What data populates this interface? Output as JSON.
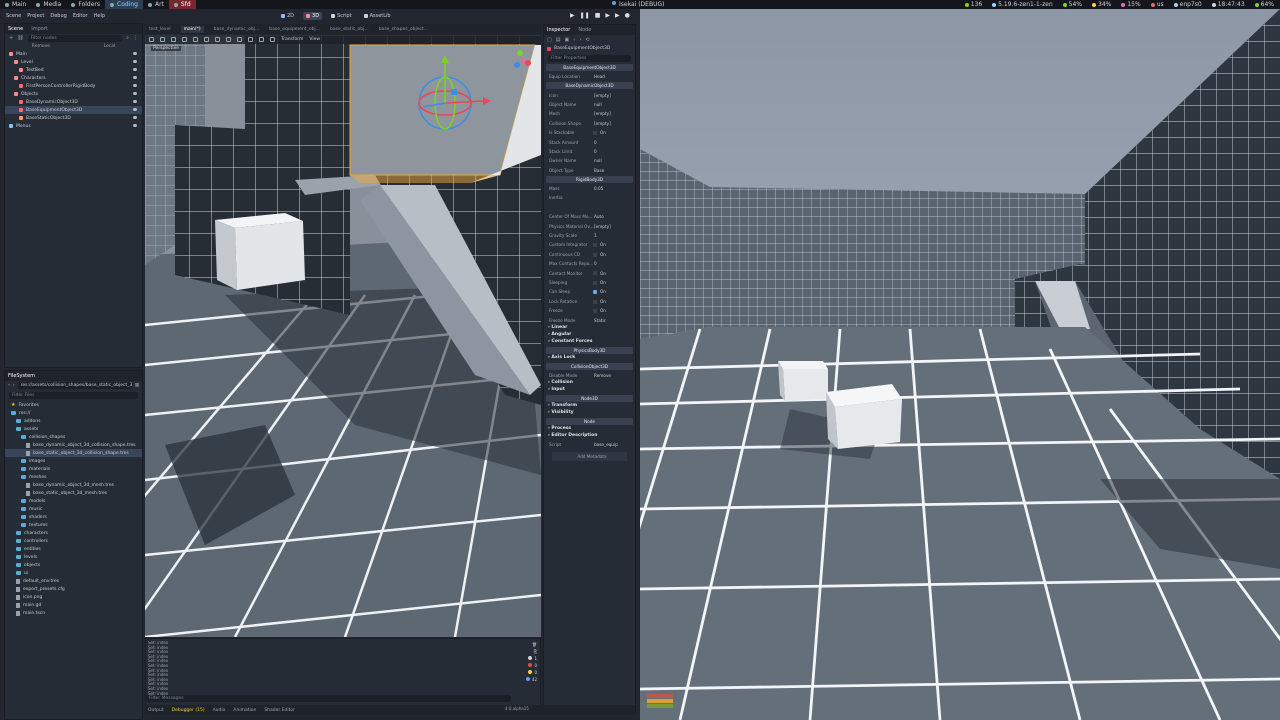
{
  "topbar": {
    "workspaces": [
      {
        "label": "Main",
        "state": "normal"
      },
      {
        "label": "Media",
        "state": "normal"
      },
      {
        "label": "Folders",
        "state": "normal"
      },
      {
        "label": "Coding",
        "state": "active"
      },
      {
        "label": "Art",
        "state": "normal"
      },
      {
        "label": "Sfd",
        "state": "red"
      }
    ],
    "window_title": "Isekai (DEBUG)",
    "stats": {
      "updates": "136",
      "kernel": "5.19.6-zen1-1-zen",
      "cpu": "54%",
      "mem": "34%",
      "disk": "15%",
      "layout": "us",
      "net": "enp7s0",
      "time": "18:47:43",
      "battery": "64%"
    }
  },
  "menu": [
    "Scene",
    "Project",
    "Debug",
    "Editor",
    "Help"
  ],
  "main_screens": [
    "2D",
    "3D",
    "Script",
    "AssetLib"
  ],
  "scene_dock": {
    "tabs": [
      "Scene",
      "Import"
    ],
    "toolbar": [
      "Remove",
      "Local"
    ],
    "filter_placeholder": "Filter nodes",
    "nodes": [
      {
        "label": "Main",
        "indent": 0,
        "icon": "node3d-icon"
      },
      {
        "label": "Level",
        "indent": 1,
        "icon": "node3d-icon"
      },
      {
        "label": "TestBed",
        "indent": 2,
        "icon": "node3d-icon"
      },
      {
        "label": "Characters",
        "indent": 1,
        "icon": "node3d-icon"
      },
      {
        "label": "FirstPersonControllerRigidBody",
        "indent": 2,
        "icon": "rigidbody-icon"
      },
      {
        "label": "Objects",
        "indent": 1,
        "icon": "node3d-icon"
      },
      {
        "label": "BaseDynamicObject3D",
        "indent": 2,
        "icon": "rigidbody-icon"
      },
      {
        "label": "BaseEquipmentObject3D",
        "indent": 2,
        "icon": "rigidbody-icon",
        "selected": true
      },
      {
        "label": "BaseStaticObject3D",
        "indent": 2,
        "icon": "staticbody-icon"
      },
      {
        "label": "Menus",
        "indent": 0,
        "icon": "control-icon"
      }
    ]
  },
  "filesystem": {
    "title": "FileSystem",
    "path": "res://assets/collision_shapes/base_static_object_3d_colli",
    "filter_placeholder": "Filter Files",
    "items": [
      {
        "label": "Favorites",
        "indent": 0,
        "type": "star"
      },
      {
        "label": "res://",
        "indent": 0,
        "type": "folder"
      },
      {
        "label": "addons",
        "indent": 1,
        "type": "folder"
      },
      {
        "label": "assets",
        "indent": 1,
        "type": "folder"
      },
      {
        "label": "collision_shapes",
        "indent": 2,
        "type": "folder"
      },
      {
        "label": "base_dynamic_object_3d_collision_shape.tres",
        "indent": 3,
        "type": "file"
      },
      {
        "label": "base_static_object_3d_collision_shape.tres",
        "indent": 3,
        "type": "file",
        "selected": true
      },
      {
        "label": "images",
        "indent": 2,
        "type": "folder"
      },
      {
        "label": "materials",
        "indent": 2,
        "type": "folder"
      },
      {
        "label": "meshes",
        "indent": 2,
        "type": "folder"
      },
      {
        "label": "base_dynamic_object_3d_mesh.tres",
        "indent": 3,
        "type": "file"
      },
      {
        "label": "base_static_object_3d_mesh.tres",
        "indent": 3,
        "type": "file"
      },
      {
        "label": "models",
        "indent": 2,
        "type": "folder"
      },
      {
        "label": "music",
        "indent": 2,
        "type": "folder"
      },
      {
        "label": "shaders",
        "indent": 2,
        "type": "folder"
      },
      {
        "label": "textures",
        "indent": 2,
        "type": "folder"
      },
      {
        "label": "characters",
        "indent": 1,
        "type": "folder"
      },
      {
        "label": "controllers",
        "indent": 1,
        "type": "folder"
      },
      {
        "label": "entities",
        "indent": 1,
        "type": "folder"
      },
      {
        "label": "levels",
        "indent": 1,
        "type": "folder"
      },
      {
        "label": "objects",
        "indent": 1,
        "type": "folder"
      },
      {
        "label": "ui",
        "indent": 1,
        "type": "folder"
      },
      {
        "label": "default_env.tres",
        "indent": 1,
        "type": "file"
      },
      {
        "label": "export_presets.cfg",
        "indent": 1,
        "type": "file"
      },
      {
        "label": "icon.png",
        "indent": 1,
        "type": "file"
      },
      {
        "label": "main.gd",
        "indent": 1,
        "type": "file"
      },
      {
        "label": "main.tscn",
        "indent": 1,
        "type": "file"
      }
    ]
  },
  "scene_tabs": [
    "test_level",
    "main(*)",
    "base_dynamic_obj...",
    "base_equipment_obj...",
    "base_static_obj...",
    "base_shapes_object..."
  ],
  "viewport": {
    "label": "Perspective",
    "toolbar": [
      "Transform",
      "View"
    ]
  },
  "inspector": {
    "tabs": [
      "Inspector",
      "Node"
    ],
    "object": "BaseEquipmentObject3D",
    "filter_placeholder": "Filter Properties",
    "rows": [
      {
        "kind": "section",
        "label": "BaseEquipmentObject3D"
      },
      {
        "kind": "prop",
        "label": "Equip Location",
        "value": "Head"
      },
      {
        "kind": "section",
        "label": "BaseDynamicObject3D"
      },
      {
        "kind": "prop",
        "label": "Icon",
        "value": "[empty]"
      },
      {
        "kind": "prop",
        "label": "Object Name",
        "value": "null"
      },
      {
        "kind": "prop",
        "label": "Mesh",
        "value": "[empty]"
      },
      {
        "kind": "prop",
        "label": "Collision Shape",
        "value": "[empty]"
      },
      {
        "kind": "check",
        "label": "Is Stackable",
        "value": "On",
        "checked": false
      },
      {
        "kind": "prop",
        "label": "Stack Amount",
        "value": "0"
      },
      {
        "kind": "prop",
        "label": "Stack Limit",
        "value": "0"
      },
      {
        "kind": "prop",
        "label": "Owner Name",
        "value": "null"
      },
      {
        "kind": "prop",
        "label": "Object Type",
        "value": "Base"
      },
      {
        "kind": "section",
        "label": "RigidBody3D"
      },
      {
        "kind": "prop",
        "label": "Mass",
        "value": "0.05"
      },
      {
        "kind": "prop",
        "label": "Inertia",
        "value": ""
      },
      {
        "kind": "prop",
        "label": "",
        "value": ""
      },
      {
        "kind": "prop",
        "label": "Center Of Mass Mo...",
        "value": "Auto"
      },
      {
        "kind": "prop",
        "label": "Physics Material Ov...",
        "value": "[empty]"
      },
      {
        "kind": "prop",
        "label": "Gravity Scale",
        "value": "1"
      },
      {
        "kind": "check",
        "label": "Custom Integrator",
        "value": "On",
        "checked": false
      },
      {
        "kind": "check",
        "label": "Continuous CD",
        "value": "On",
        "checked": false
      },
      {
        "kind": "prop",
        "label": "Max Contacts Repo...",
        "value": "0"
      },
      {
        "kind": "check",
        "label": "Contact Monitor",
        "value": "On",
        "checked": false
      },
      {
        "kind": "check",
        "label": "Sleeping",
        "value": "On",
        "checked": false
      },
      {
        "kind": "check",
        "label": "Can Sleep",
        "value": "On",
        "checked": true
      },
      {
        "kind": "check",
        "label": "Lock Rotation",
        "value": "On",
        "checked": false
      },
      {
        "kind": "check",
        "label": "Freeze",
        "value": "On",
        "checked": false
      },
      {
        "kind": "prop",
        "label": "Freeze Mode",
        "value": "Static"
      },
      {
        "kind": "group",
        "label": "Linear"
      },
      {
        "kind": "group",
        "label": "Angular"
      },
      {
        "kind": "group",
        "label": "Constant Forces"
      },
      {
        "kind": "section",
        "label": "PhysicsBody3D"
      },
      {
        "kind": "group",
        "label": "Axis Lock"
      },
      {
        "kind": "section",
        "label": "CollisionObject3D"
      },
      {
        "kind": "prop",
        "label": "Disable Mode",
        "value": "Remove"
      },
      {
        "kind": "group",
        "label": "Collision"
      },
      {
        "kind": "group",
        "label": "Input"
      },
      {
        "kind": "section",
        "label": "Node3D"
      },
      {
        "kind": "group",
        "label": "Transform"
      },
      {
        "kind": "group",
        "label": "Visibility"
      },
      {
        "kind": "section",
        "label": "Node"
      },
      {
        "kind": "group",
        "label": "Process"
      },
      {
        "kind": "group",
        "label": "Editor Description"
      },
      {
        "kind": "prop",
        "label": "Script",
        "value": "base_equip"
      },
      {
        "kind": "button",
        "label": "Add Metadata"
      }
    ]
  },
  "output": {
    "lines": [
      "Set: index",
      "Set: index",
      "Set: index",
      "Set: index",
      "Set: index",
      "Set: index",
      "Set: index",
      "Set: index",
      "Set: index",
      "Set: index",
      "Set: index",
      "Set: index"
    ],
    "filter_placeholder": "Filter Messages",
    "counts": [
      "1",
      "0",
      "0",
      "42"
    ]
  },
  "bottom_tabs": [
    "Output",
    "Debugger (15)",
    "Audio",
    "Animation",
    "Shader Editor"
  ],
  "version": "4.0.alpha15",
  "colors": {
    "accent": "#5aa0e6",
    "selection": "#37465a",
    "red_ws": "#7a2530",
    "gizmo_x": "#e8475a",
    "gizmo_y": "#7ed321",
    "gizmo_z": "#3a8ee6",
    "selected_outline": "#f0a838"
  }
}
